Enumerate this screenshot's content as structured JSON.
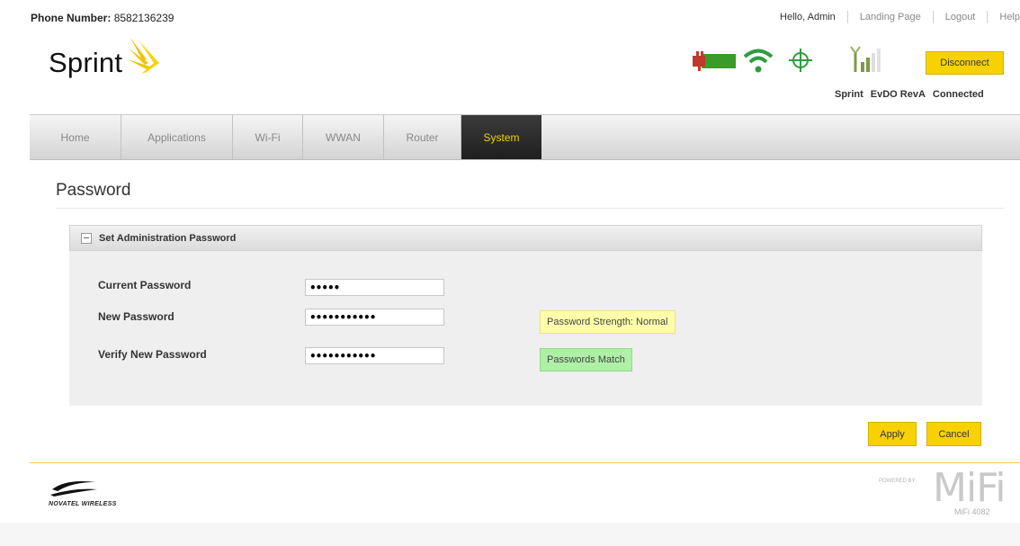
{
  "header": {
    "phone_label": "Phone Number:",
    "phone_number": "8582136239",
    "greeting": "Hello, Admin",
    "links": {
      "landing": "Landing Page",
      "logout": "Logout",
      "help": "Help"
    },
    "brand": "Sprint",
    "disconnect_label": "Disconnect",
    "status": {
      "carrier": "Sprint",
      "network": "EvDO RevA",
      "connection": "Connected"
    }
  },
  "nav": {
    "tabs": [
      {
        "label": "Home"
      },
      {
        "label": "Applications"
      },
      {
        "label": "Wi-Fi"
      },
      {
        "label": "WWAN"
      },
      {
        "label": "Router"
      },
      {
        "label": "System",
        "active": true
      }
    ]
  },
  "page": {
    "title": "Password",
    "panel": {
      "title": "Set Administration Password",
      "fields": [
        {
          "label": "Current Password",
          "value": "•••••"
        },
        {
          "label": "New Password",
          "value": "•••••••••••"
        },
        {
          "label": "Verify New Password",
          "value": "•••••••••••"
        }
      ],
      "strength_text": "Password Strength: Normal",
      "match_text": "Passwords Match"
    },
    "apply_label": "Apply",
    "cancel_label": "Cancel"
  },
  "footer": {
    "novatel_text": "NOVATEL WIRELESS",
    "powered_text": "POWERED BY",
    "mifi_logo": "MiFi",
    "mifi_model": "MiFi 4082"
  },
  "colors": {
    "accent_yellow": "#f7d200",
    "active_tab_bg": "#2b2b2b",
    "active_tab_text": "#f2d300",
    "battery_green": "#3a9a2a",
    "battery_red": "#c0392b",
    "status_green": "#2e9e3f",
    "strength_bg": "#ffffaa",
    "match_bg": "#aef0a6"
  },
  "icons": [
    "sprint-logo-icon",
    "battery-icon",
    "wifi-icon",
    "gps-icon",
    "signal-bars-icon",
    "collapse-icon",
    "novatel-logo-icon"
  ]
}
